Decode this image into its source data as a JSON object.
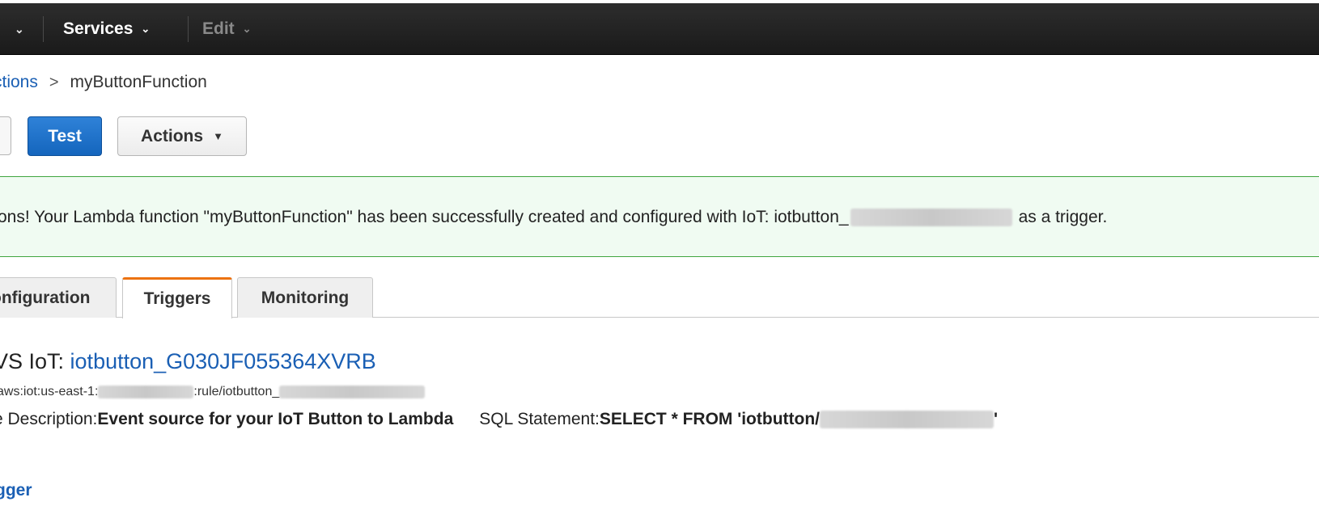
{
  "nav": {
    "services_label": "Services",
    "edit_label": "Edit"
  },
  "breadcrumb": {
    "parent": "ctions",
    "separator": ">",
    "current": "myButtonFunction"
  },
  "toolbar": {
    "test_label": "Test",
    "actions_label": "Actions"
  },
  "banner": {
    "text_before": "ons! Your Lambda function \"myButtonFunction\" has been successfully created and configured with IoT: iotbutton_",
    "text_after": "as a trigger.",
    "accent_color": "#3fa53f",
    "background_color": "#f0fbf2"
  },
  "tabs": [
    {
      "label": "onfiguration"
    },
    {
      "label": "Triggers",
      "active": true
    },
    {
      "label": "Monitoring"
    }
  ],
  "trigger": {
    "title_prefix": "VS IoT: ",
    "name": "iotbutton_G030JF055364XVRB",
    "arn_prefix": "aws:iot:us-east-1:",
    "arn_middle": ":rule/iotbutton_",
    "description_label": "e Description: ",
    "description_value": "Event source for your IoT Button to Lambda",
    "sql_label": "SQL Statement: ",
    "sql_value_prefix": "SELECT * FROM 'iotbutton/",
    "sql_value_suffix": "'"
  },
  "add_trigger_label": "gger",
  "colors": {
    "primary_button": "#1d6fc9",
    "link": "#1a5fb4",
    "active_tab_accent": "#ec7211",
    "topbar": "#232323"
  }
}
